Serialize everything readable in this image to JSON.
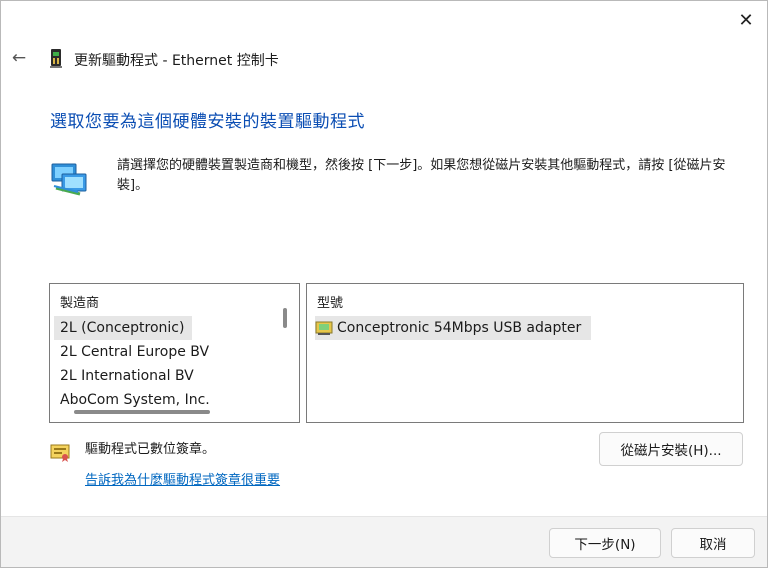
{
  "window": {
    "title": "更新驅動程式 - Ethernet 控制卡",
    "close_glyph": "✕",
    "back_glyph": "←"
  },
  "main": {
    "heading": "選取您要為這個硬體安裝的裝置驅動程式",
    "instruction": "請選擇您的硬體裝置製造商和機型，然後按 [下一步]。如果您想從磁片安裝其他驅動程式，請按 [從磁片安裝]。"
  },
  "manufacturer_list": {
    "header": "製造商",
    "items": [
      {
        "label": "2L (Conceptronic)",
        "selected": true
      },
      {
        "label": "2L Central Europe BV",
        "selected": false
      },
      {
        "label": "2L International BV",
        "selected": false
      },
      {
        "label": "AboCom System, Inc.",
        "selected": false
      }
    ]
  },
  "model_list": {
    "header": "型號",
    "items": [
      {
        "label": "Conceptronic 54Mbps USB adapter",
        "selected": true
      }
    ]
  },
  "signature": {
    "status": "驅動程式已數位簽章。",
    "link": "告訴我為什麼驅動程式簽章很重要"
  },
  "buttons": {
    "have_disk": "從磁片安裝(H)...",
    "next": "下一步(N)",
    "cancel": "取消"
  },
  "icons": {
    "title": "network-adapter-card-icon",
    "heading": "network-computers-icon",
    "model_item": "driver-package-icon",
    "signature": "certificate-icon"
  },
  "colors": {
    "heading": "#0a4db3",
    "link": "#0067c0",
    "selection": "#e6e6e6",
    "footer_bg": "#f3f3f3"
  }
}
